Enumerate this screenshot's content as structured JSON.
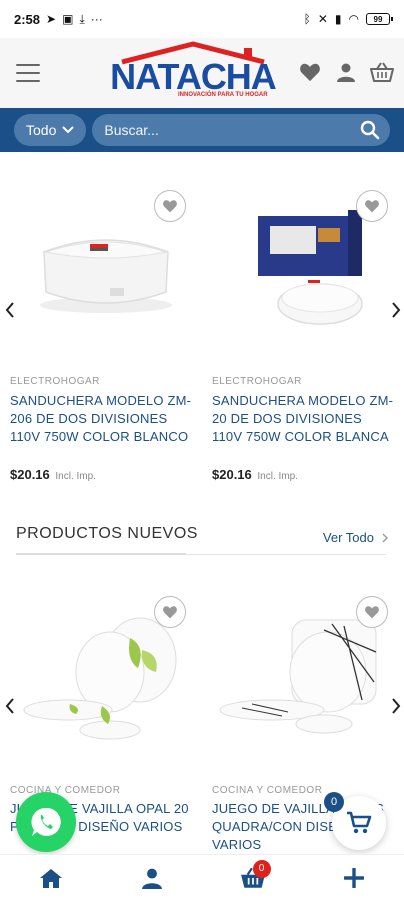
{
  "status_bar": {
    "time": "2:58",
    "battery": "99"
  },
  "header": {
    "logo_text": "NATACHA",
    "logo_tagline": "INNOVACIÓN PARA TU HOGAR",
    "icons": [
      "menu-icon",
      "heart-icon",
      "user-icon",
      "basket-icon"
    ]
  },
  "search": {
    "category_label": "Todo",
    "placeholder": "Buscar..."
  },
  "featured": {
    "products": [
      {
        "category": "ELECTROHOGAR",
        "title": "SANDUCHERA MODELO ZM-206 DE DOS DIVISIONES 110V 750W COLOR BLANCO",
        "price": "$20.16",
        "tax_note": "Incl. Imp."
      },
      {
        "category": "ELECTROHOGAR",
        "title": "SANDUCHERA MODELO ZM-20 DE DOS DIVISIONES 110V 750W COLOR BLANCA",
        "price": "$20.16",
        "tax_note": "Incl. Imp."
      }
    ]
  },
  "new_products": {
    "title": "PRODUCTOS NUEVOS",
    "view_all": "Ver Todo",
    "products": [
      {
        "category": "COCINA Y COMEDOR",
        "title": "JUEGO DE VAJILLA OPAL 20 PCS /CON DISEÑO VARIOS"
      },
      {
        "category": "COCINA Y COMEDOR",
        "title": "JUEGO DE VAJILLA 20 PCS QUADRA/CON DISEÑO VARIOS"
      }
    ]
  },
  "floating": {
    "cart_count": "0"
  },
  "bottom_nav": {
    "cart_badge": "0"
  },
  "colors": {
    "primary": "#1b4f87",
    "accent_red": "#e0201b",
    "whatsapp": "#25d366"
  }
}
